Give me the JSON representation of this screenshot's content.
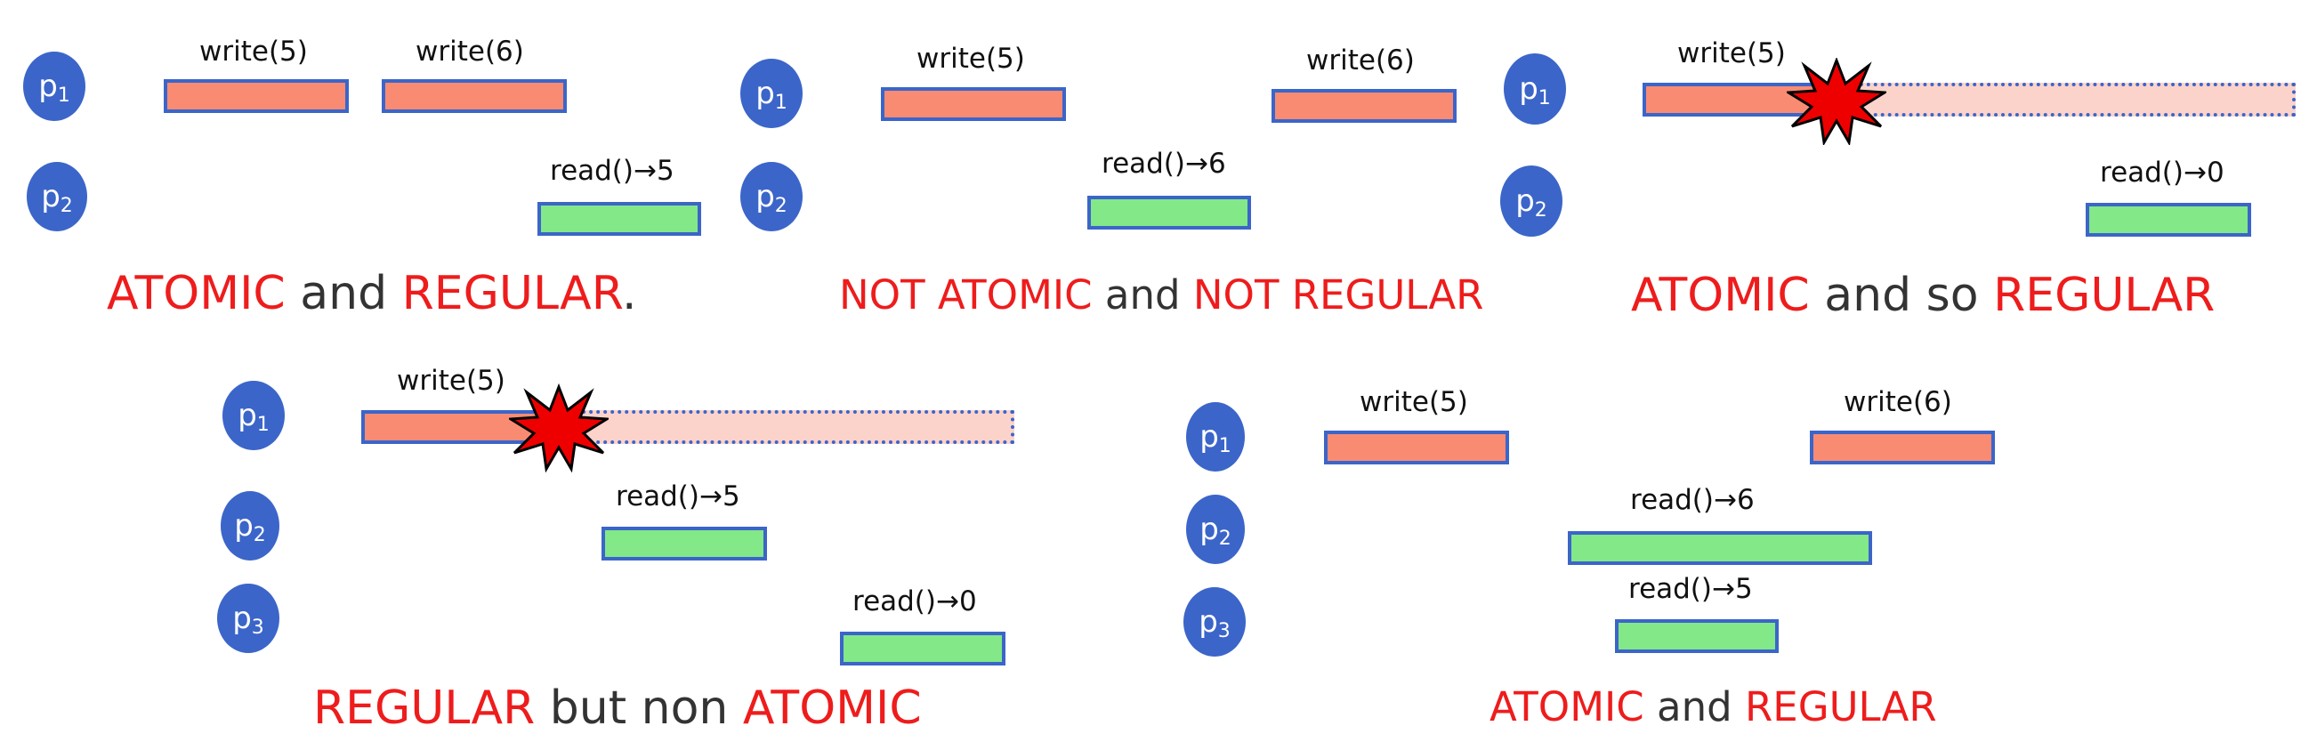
{
  "scenarios": [
    {
      "processes": [
        {
          "label": "p",
          "sub": "1"
        },
        {
          "label": "p",
          "sub": "2"
        }
      ],
      "ops": [
        "write(5)",
        "write(6)",
        "read()→5"
      ],
      "caption": {
        "hl1": "ATOMIC",
        "mid": " and ",
        "hl2": "REGULAR",
        "tail": "."
      }
    },
    {
      "processes": [
        {
          "label": "p",
          "sub": "1"
        },
        {
          "label": "p",
          "sub": "2"
        }
      ],
      "ops": [
        "write(5)",
        "write(6)",
        "read()→6"
      ],
      "caption": {
        "hl1": "NOT ATOMIC",
        "mid": " and ",
        "hl2": "NOT REGULAR",
        "tail": ""
      }
    },
    {
      "processes": [
        {
          "label": "p",
          "sub": "1"
        },
        {
          "label": "p",
          "sub": "2"
        }
      ],
      "ops": [
        "write(5)",
        "read()→0"
      ],
      "caption": {
        "hl1": "ATOMIC",
        "mid": " and so ",
        "hl2": "REGULAR",
        "tail": ""
      }
    },
    {
      "processes": [
        {
          "label": "p",
          "sub": "1"
        },
        {
          "label": "p",
          "sub": "2"
        },
        {
          "label": "p",
          "sub": "3"
        }
      ],
      "ops": [
        "write(5)",
        "read()→5",
        "read()→0"
      ],
      "caption": {
        "hl1": "REGULAR",
        "mid": " but non ",
        "hl2": "ATOMIC",
        "tail": ""
      }
    },
    {
      "processes": [
        {
          "label": "p",
          "sub": "1"
        },
        {
          "label": "p",
          "sub": "2"
        },
        {
          "label": "p",
          "sub": "3"
        }
      ],
      "ops": [
        "write(5)",
        "write(6)",
        "read()→6",
        "read()→5"
      ],
      "caption": {
        "hl1": "ATOMIC",
        "mid": " and ",
        "hl2": "REGULAR",
        "tail": ""
      }
    }
  ],
  "colors": {
    "process": "#3b65c9",
    "write_bar": "#fa8b73",
    "read_bar": "#82e888",
    "crashed_write_tail": "#fcd3cb",
    "bar_border": "#3b65c9",
    "highlight_text": "#ee1c1c",
    "plain_text": "#333333",
    "crash_fill": "#ee0000"
  },
  "icons": {
    "crash": "crash-burst-icon"
  }
}
